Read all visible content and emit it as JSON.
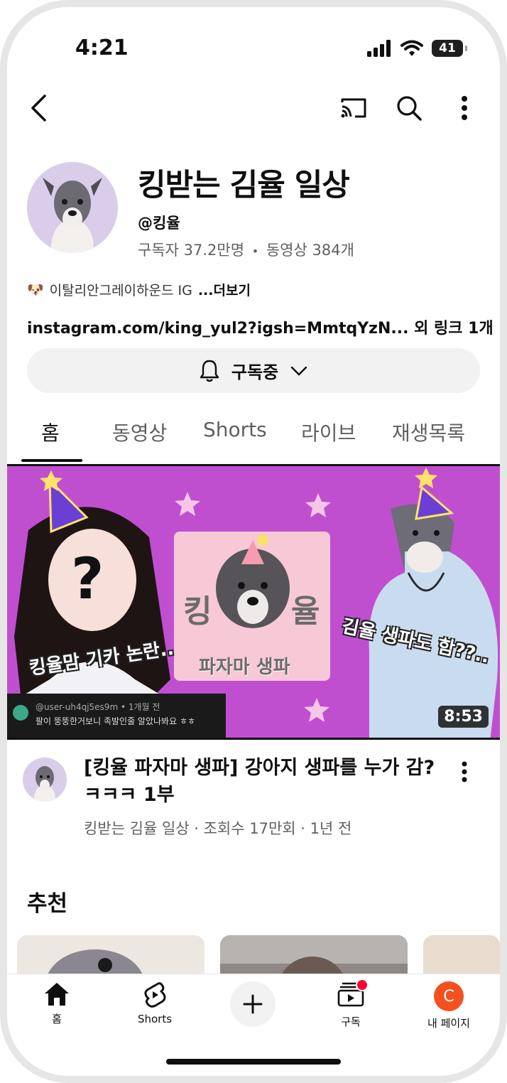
{
  "status_bar": {
    "time": "4:21",
    "battery": "41"
  },
  "header": {
    "back_icon": "chevron-left-icon",
    "cast_icon": "cast-icon",
    "search_icon": "search-icon",
    "more_icon": "more-vert-icon"
  },
  "channel": {
    "title": "킹받는 김율 일상",
    "handle": "@킹율",
    "subscribers": "구독자 37.2만명",
    "separator": "•",
    "videos": "동영상 384개",
    "description_emoji": "🐶",
    "description": "이탈리안그레이하운드 IG",
    "more_label": "...더보기",
    "link": "instagram.com/king_yul2?igsh=MmtqYzN... 외 링크 1개"
  },
  "subscribe_button": {
    "label": "구독중"
  },
  "tabs": [
    {
      "label": "홈",
      "active": true
    },
    {
      "label": "동영상",
      "active": false
    },
    {
      "label": "Shorts",
      "active": false
    },
    {
      "label": "라이브",
      "active": false
    },
    {
      "label": "재생목록",
      "active": false
    }
  ],
  "featured_video": {
    "thumbnail_text_left": "킹율맘 기카 논란..",
    "thumbnail_text_right": "김율 생파도 함??..",
    "thumbnail_text_center_left": "킹",
    "thumbnail_text_center_right": "율",
    "thumbnail_text_center_bottom": "파자마 생파",
    "thumbnail_comment_user": "@user-uh4qj5es9m • 1개월 전",
    "thumbnail_comment_text": "팔이 뚱뚱한거보니 족발인줄 알았나봐요 ㅎㅎ",
    "duration": "8:53",
    "title": "[킹율 파자마 생파] 강아지 생파를 누가 감? ㅋㅋㅋ 1부",
    "meta": "킹받는 김율 일상 · 조회수 17만회 · 1년 전"
  },
  "section": {
    "title": "추천"
  },
  "bottom_nav": {
    "home": "홈",
    "shorts": "Shorts",
    "subscriptions": "구독",
    "profile": "내 페이지",
    "avatar_letter": "C"
  },
  "colors": {
    "thumbnail_bg": "#c04fd0",
    "notification_dot": "#ff0033",
    "avatar_bg": "#f4511e"
  }
}
